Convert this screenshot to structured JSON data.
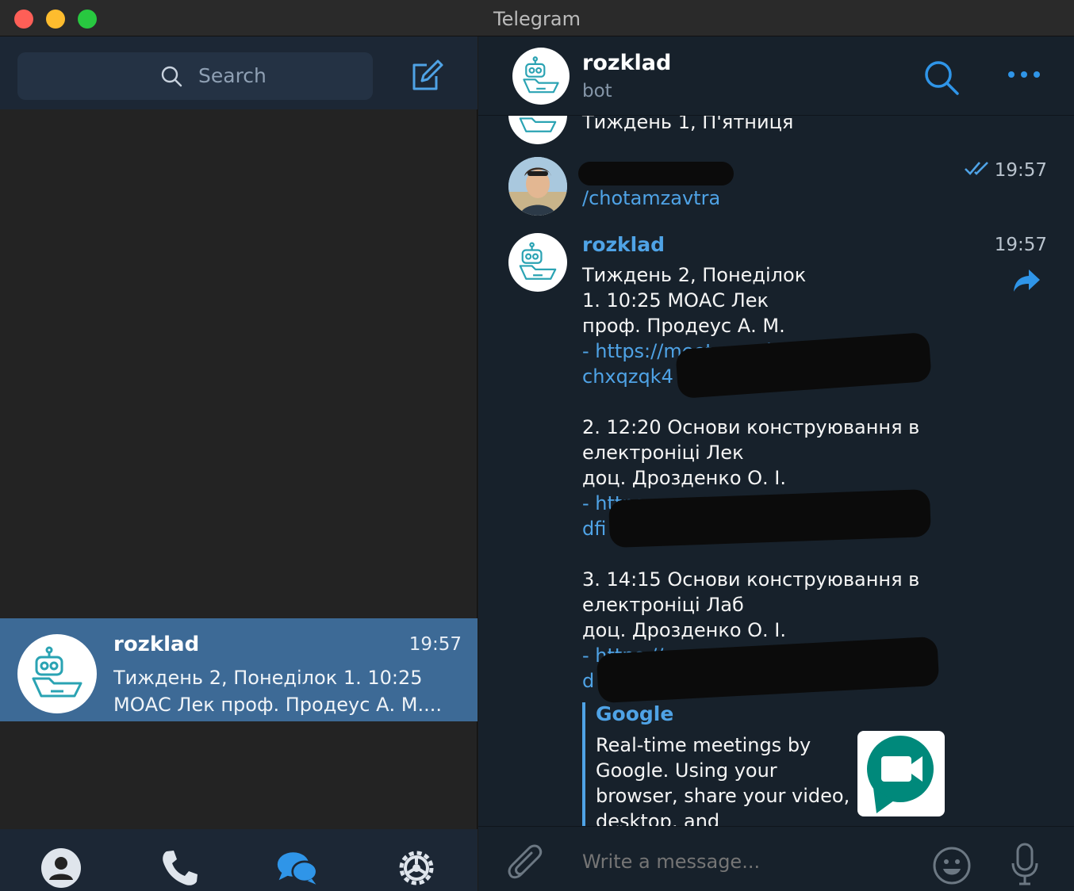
{
  "window": {
    "title": "Telegram"
  },
  "sidebar": {
    "search_placeholder": "Search",
    "chats": [
      {
        "name": "rozklad",
        "time": "19:57",
        "preview_line1": "Тиждень 2, Понеділок 1. 10:25",
        "preview_line2": "МОАС Лек проф. Продеус А. М...."
      }
    ],
    "nav_icons": [
      "contacts-icon",
      "calls-icon",
      "chats-icon",
      "settings-icon"
    ]
  },
  "chat": {
    "name": "rozklad",
    "status": "bot",
    "partial_top_text": "Тиждень 1, П'ятниця",
    "messages": [
      {
        "sender_redacted": true,
        "text": "/chotamzavtra",
        "time": "19:57",
        "read_status": "double-check"
      },
      {
        "sender": "rozklad",
        "time": "19:57",
        "lines": [
          "Тиждень 2, Понеділок",
          "1. 10:25 МОАС Лек",
          "проф. Продеус А. М.",
          "-  https://meet.google",
          "chxqzqk4",
          "",
          "2. 12:20 Основи конструювання в",
          "електроніці Лек",
          "доц. Дрозденко О. І.",
          "-  https:",
          "dfi",
          "",
          "3. 14:15 Основи конструювання в",
          "електроніці Лаб",
          "доц. Дрозденко О. І.",
          "-  https://meet.google",
          "d"
        ],
        "link_preview": {
          "site": "Google",
          "description": "Real-time meetings by\nGoogle. Using your\nbrowser, share your video,\ndesktop, and"
        }
      }
    ]
  },
  "composer": {
    "placeholder": "Write a message..."
  },
  "colors": {
    "accent": "#4fa3e6",
    "selected_chat": "#3d6a96",
    "panel_dark": "#17212b",
    "meet_green": "#00897b"
  }
}
